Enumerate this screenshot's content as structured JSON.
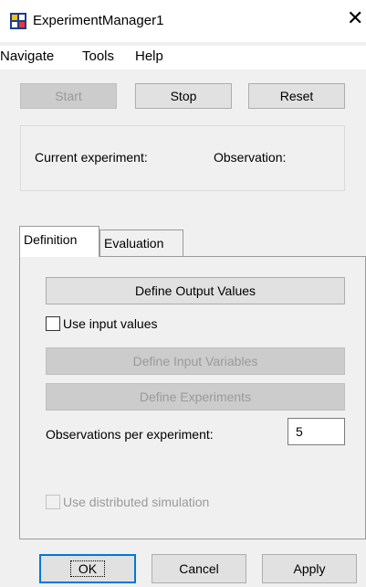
{
  "window": {
    "title": "ExperimentManager1",
    "close_icon": "close-icon",
    "app_icon": "experiment-manager-icon"
  },
  "menu": [
    "Navigate",
    "Tools",
    "Help"
  ],
  "controls": {
    "start": "Start",
    "stop": "Stop",
    "reset": "Reset"
  },
  "status": {
    "current_experiment": "Current experiment:",
    "observation": "Observation:"
  },
  "tabs": [
    "Definition",
    "Evaluation"
  ],
  "definition": {
    "define_output": "Define Output Values",
    "use_input_values": "Use input values",
    "use_input_values_checked": false,
    "define_input": "Define Input Variables",
    "define_experiments": "Define Experiments",
    "observations_label": "Observations per experiment:",
    "observations_value": "5",
    "use_distributed": "Use distributed simulation",
    "use_distributed_checked": false
  },
  "footer": {
    "ok": "OK",
    "cancel": "Cancel",
    "apply": "Apply"
  },
  "colors": {
    "accent": "#0078d7",
    "disabled_text": "#9a9a9a"
  }
}
